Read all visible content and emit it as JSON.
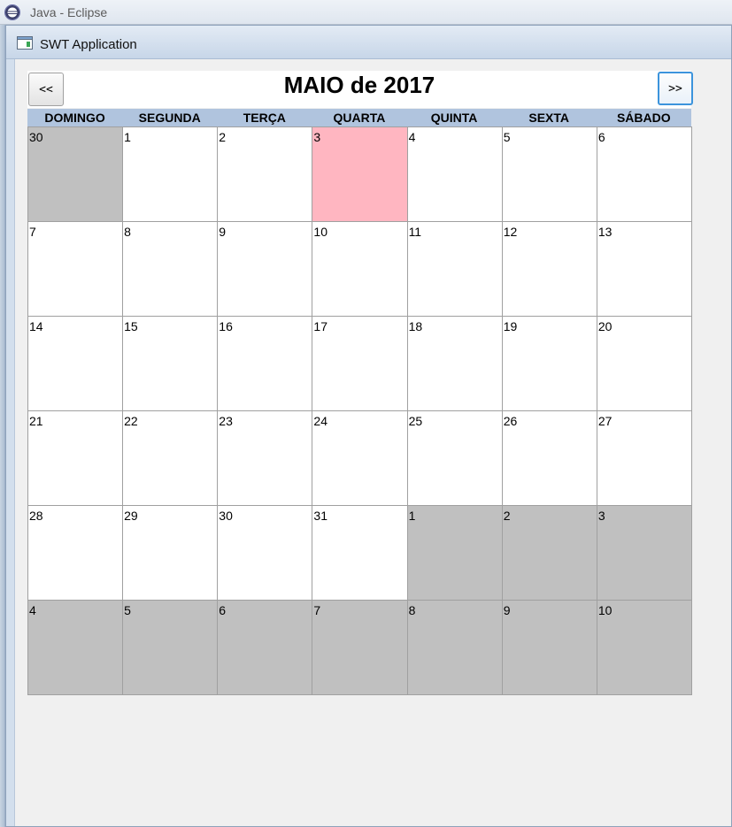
{
  "eclipse_window": {
    "title": "Java - Eclipse",
    "icon": "eclipse-icon"
  },
  "app_window": {
    "title": "SWT Application",
    "icon": "swt-app-icon"
  },
  "calendar": {
    "month_title": "MAIO de 2017",
    "prev_label": "<<",
    "next_label": ">>",
    "weekdays": [
      "DOMINGO",
      "SEGUNDA",
      "TERÇA",
      "QUARTA",
      "QUINTA",
      "SEXTA",
      "SÁBADO"
    ],
    "colors": {
      "header_bg": "#b0c4de",
      "other_month": "#c0c0c0",
      "highlighted": "#ffb6c1",
      "current_month": "#ffffff"
    },
    "days": [
      {
        "day": "30",
        "state": "other"
      },
      {
        "day": "1",
        "state": "current"
      },
      {
        "day": "2",
        "state": "current"
      },
      {
        "day": "3",
        "state": "today"
      },
      {
        "day": "4",
        "state": "current"
      },
      {
        "day": "5",
        "state": "current"
      },
      {
        "day": "6",
        "state": "current"
      },
      {
        "day": "7",
        "state": "current"
      },
      {
        "day": "8",
        "state": "current"
      },
      {
        "day": "9",
        "state": "current"
      },
      {
        "day": "10",
        "state": "current"
      },
      {
        "day": "11",
        "state": "current"
      },
      {
        "day": "12",
        "state": "current"
      },
      {
        "day": "13",
        "state": "current"
      },
      {
        "day": "14",
        "state": "current"
      },
      {
        "day": "15",
        "state": "current"
      },
      {
        "day": "16",
        "state": "current"
      },
      {
        "day": "17",
        "state": "current"
      },
      {
        "day": "18",
        "state": "current"
      },
      {
        "day": "19",
        "state": "current"
      },
      {
        "day": "20",
        "state": "current"
      },
      {
        "day": "21",
        "state": "current"
      },
      {
        "day": "22",
        "state": "current"
      },
      {
        "day": "23",
        "state": "current"
      },
      {
        "day": "24",
        "state": "current"
      },
      {
        "day": "25",
        "state": "current"
      },
      {
        "day": "26",
        "state": "current"
      },
      {
        "day": "27",
        "state": "current"
      },
      {
        "day": "28",
        "state": "current"
      },
      {
        "day": "29",
        "state": "current"
      },
      {
        "day": "30",
        "state": "current"
      },
      {
        "day": "31",
        "state": "current"
      },
      {
        "day": "1",
        "state": "other"
      },
      {
        "day": "2",
        "state": "other"
      },
      {
        "day": "3",
        "state": "other"
      },
      {
        "day": "4",
        "state": "other"
      },
      {
        "day": "5",
        "state": "other"
      },
      {
        "day": "6",
        "state": "other"
      },
      {
        "day": "7",
        "state": "other"
      },
      {
        "day": "8",
        "state": "other"
      },
      {
        "day": "9",
        "state": "other"
      },
      {
        "day": "10",
        "state": "other"
      }
    ]
  }
}
